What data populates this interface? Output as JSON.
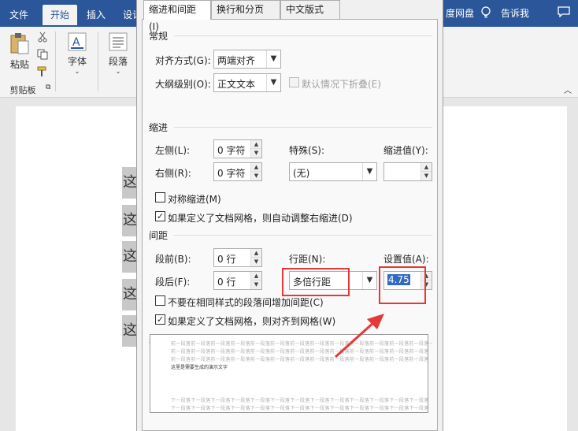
{
  "ribbon": {
    "tabs": [
      "文件",
      "开始",
      "插入",
      "设计"
    ],
    "right_items": [
      "度网盘",
      "告诉我"
    ],
    "buttons": {
      "paste": "粘贴",
      "font": "字体",
      "paragraph": "段落"
    },
    "group_label": "剪贴板"
  },
  "document": {
    "chars": [
      "这",
      "这",
      "这",
      "这",
      "这"
    ]
  },
  "dialog": {
    "tabs": [
      "缩进和间距(I)",
      "换行和分页(P)",
      "中文版式(H)"
    ],
    "general": {
      "section": "常规",
      "alignment_label": "对齐方式(G):",
      "alignment_value": "两端对齐",
      "outline_label": "大纲级别(O):",
      "outline_value": "正文文本",
      "collapse_label": "默认情况下折叠(E)"
    },
    "indent": {
      "section": "缩进",
      "left_label": "左侧(L):",
      "left_value": "0 字符",
      "right_label": "右侧(R):",
      "right_value": "0 字符",
      "special_label": "特殊(S):",
      "special_value": "(无)",
      "by_label": "缩进值(Y):",
      "mirror_label": "对称缩进(M)",
      "grid_label": "如果定义了文档网格，则自动调整右缩进(D)"
    },
    "spacing": {
      "section": "间距",
      "before_label": "段前(B):",
      "before_value": "0 行",
      "after_label": "段后(F):",
      "after_value": "0 行",
      "line_label": "行距(N):",
      "line_value": "多倍行距",
      "at_label": "设置值(A):",
      "at_value": "4.75",
      "no_space_label": "不要在相同样式的段落间增加间距(C)",
      "snap_label": "如果定义了文档网格，则对齐到网格(W)"
    },
    "preview": {
      "section": "预览",
      "sample": "这里是需要生成的演示文字",
      "prev_line": "前一段落前一段落前一段落前一段落前一段落前一段落前一段落前一段落前一段落前一段落前一段落前一段落前一段落",
      "next_line": "下一段落下一段落下一段落下一段落下一段落下一段落下一段落下一段落下一段落下一段落下一段落下一段落下一段落"
    }
  },
  "colors": {
    "accent": "#2b579a",
    "annotation": "#e53935",
    "selection": "#316ac5"
  }
}
